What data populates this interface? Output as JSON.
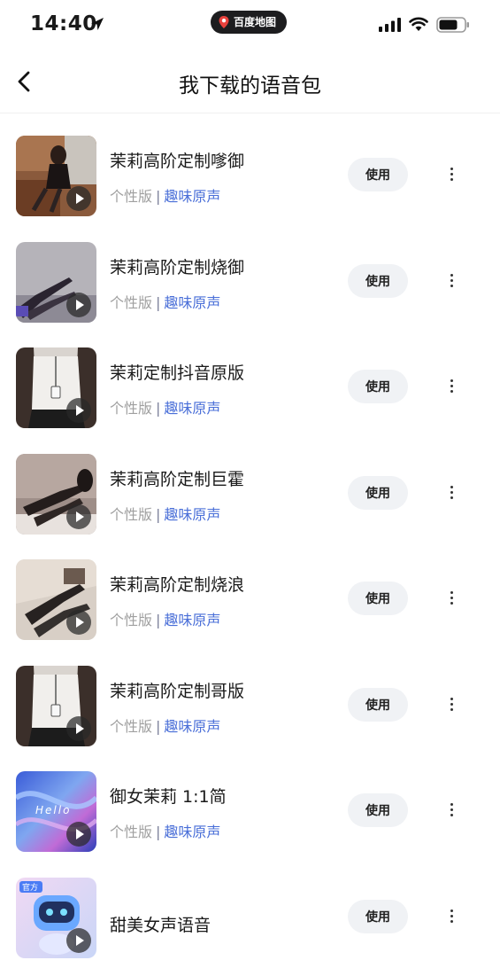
{
  "status_bar": {
    "time": "14:40",
    "app_pill": "百度地图",
    "icons": [
      "location-arrow-icon",
      "signal-icon",
      "wifi-icon",
      "battery-icon"
    ]
  },
  "nav": {
    "title": "我下载的语音包",
    "back_icon": "chevron-left-icon"
  },
  "list": {
    "action_label": "使用",
    "separator": "|",
    "items": [
      {
        "title": "茉莉高阶定制嗲御",
        "edition": "个性版",
        "tag": "趣味原声"
      },
      {
        "title": "茉莉高阶定制烧御",
        "edition": "个性版",
        "tag": "趣味原声"
      },
      {
        "title": "茉莉定制抖音原版",
        "edition": "个性版",
        "tag": "趣味原声"
      },
      {
        "title": "茉莉高阶定制巨霍",
        "edition": "个性版",
        "tag": "趣味原声"
      },
      {
        "title": "茉莉高阶定制烧浪",
        "edition": "个性版",
        "tag": "趣味原声"
      },
      {
        "title": "茉莉高阶定制哥版",
        "edition": "个性版",
        "tag": "趣味原声"
      },
      {
        "title": "御女茉莉 1:1简",
        "edition": "个性版",
        "tag": "趣味原声",
        "thumb_text": "Hello"
      },
      {
        "title": "甜美女声语音",
        "thumb_badge": "官方"
      }
    ]
  },
  "colors": {
    "accent_tag": "#4a6fd8",
    "muted": "#a0a0a0",
    "button_bg": "#f0f2f5"
  }
}
